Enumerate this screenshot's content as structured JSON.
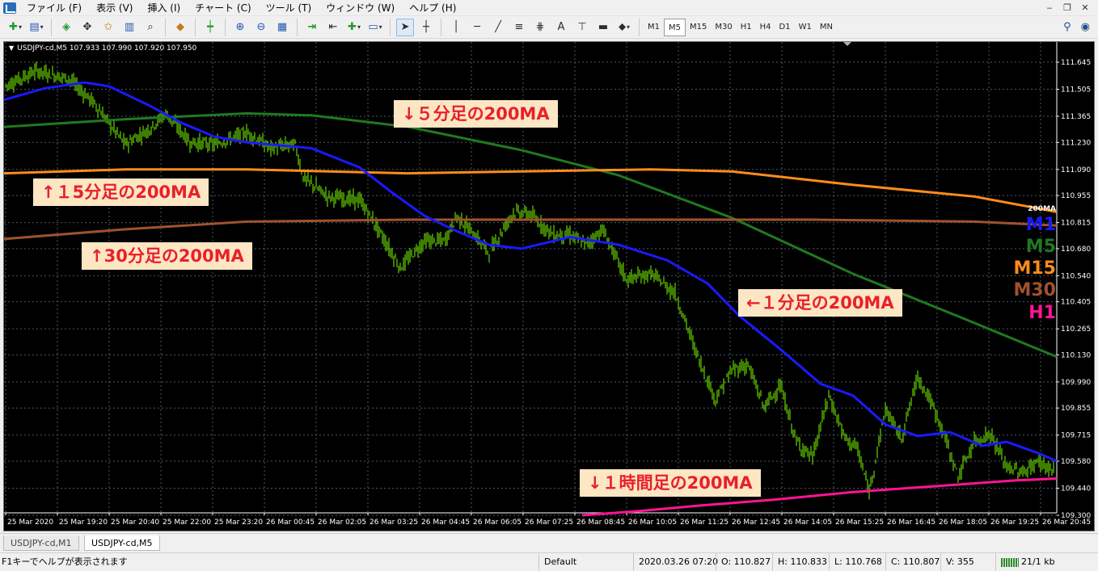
{
  "menu": {
    "items": [
      "ファイル (F)",
      "表示 (V)",
      "挿入 (I)",
      "チャート (C)",
      "ツール (T)",
      "ウィンドウ (W)",
      "ヘルプ (H)"
    ],
    "window_controls": [
      "‒",
      "❐",
      "✕"
    ]
  },
  "toolbar": {
    "timeframes": [
      "M1",
      "M5",
      "M15",
      "M30",
      "H1",
      "H4",
      "D1",
      "W1",
      "MN"
    ],
    "active_timeframe": "M5",
    "text_tool_label": "A"
  },
  "chart": {
    "title": "USDJPY-cd,M5  107.933 107.990 107.920 107.950",
    "background": "#000000",
    "price_labels": [
      "111.645",
      "111.505",
      "111.365",
      "111.230",
      "111.090",
      "110.955",
      "110.815",
      "110.680",
      "110.540",
      "110.405",
      "110.265",
      "110.130",
      "109.990",
      "109.855",
      "109.715",
      "109.580",
      "109.440",
      "109.300"
    ],
    "time_labels": [
      "25 Mar 2020",
      "25 Mar 19:20",
      "25 Mar 20:40",
      "25 Mar 22:00",
      "25 Mar 23:20",
      "26 Mar 00:45",
      "26 Mar 02:05",
      "26 Mar 03:25",
      "26 Mar 04:45",
      "26 Mar 06:05",
      "26 Mar 07:25",
      "26 Mar 08:45",
      "26 Mar 10:05",
      "26 Mar 11:25",
      "26 Mar 12:45",
      "26 Mar 14:05",
      "26 Mar 15:25",
      "26 Mar 16:45",
      "26 Mar 18:05",
      "26 Mar 19:25",
      "26 Mar 20:45"
    ],
    "annotations": {
      "ma5": "↓５分足の200MA",
      "ma15": "↑１5分足の200MA",
      "ma30": "↑30分足の200MA",
      "ma1": "←１分足の200MA",
      "h1": "↓１時間足の200MA"
    },
    "legend": {
      "title": "200MA",
      "items": [
        {
          "label": "M1",
          "color": "#1a1aff"
        },
        {
          "label": "M5",
          "color": "#1f7a1f"
        },
        {
          "label": "M15",
          "color": "#ff8c1a"
        },
        {
          "label": "M30",
          "color": "#a0522d"
        },
        {
          "label": "H1",
          "color": "#ff1493"
        }
      ]
    },
    "colors": {
      "candles": "#7CFC00",
      "ma_m1": "#1a1aff",
      "ma_m5": "#1f7a1f",
      "ma_m15": "#ff8c1a",
      "ma_m30": "#a0522d",
      "ma_h1": "#ff1493",
      "grid": "#4a5a6a"
    }
  },
  "tabs": [
    "USDJPY-cd,M1",
    "USDJPY-cd,M5"
  ],
  "active_tab": "USDJPY-cd,M5",
  "status": {
    "help": "F1キーでヘルプが表示されます",
    "profile": "Default",
    "datetime": "2020.03.26 07:20",
    "open": "O: 110.827",
    "high": "H: 110.833",
    "low": "L: 110.768",
    "close": "C: 110.807",
    "volume": "V: 355",
    "traffic": "21/1 kb"
  }
}
